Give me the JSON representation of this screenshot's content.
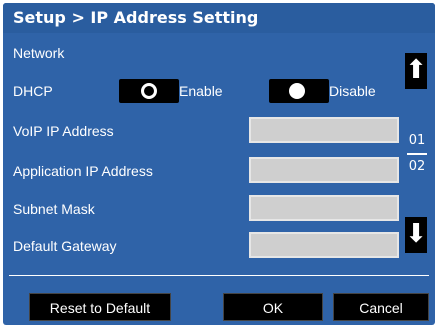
{
  "window": {
    "title": "Setup > IP Address Setting"
  },
  "network": {
    "section_label": "Network",
    "dhcp_label": "DHCP",
    "enable_label": "Enable",
    "disable_label": "Disable",
    "selected": "disable"
  },
  "fields": [
    {
      "label": "VoIP IP Address",
      "value": ""
    },
    {
      "label": "Application IP Address",
      "value": ""
    },
    {
      "label": "Subnet Mask",
      "value": ""
    },
    {
      "label": "Default Gateway",
      "value": ""
    }
  ],
  "pager": {
    "current": "01",
    "total": "02"
  },
  "buttons": {
    "reset_label": "Reset to Default",
    "ok_label": "OK",
    "cancel_label": "Cancel"
  },
  "icons": {
    "up": "up-arrow-icon",
    "down": "down-arrow-icon"
  },
  "colors": {
    "background": "#2f63a8",
    "field": "#cfcfcf",
    "button": "#000000",
    "text": "#ffffff"
  }
}
